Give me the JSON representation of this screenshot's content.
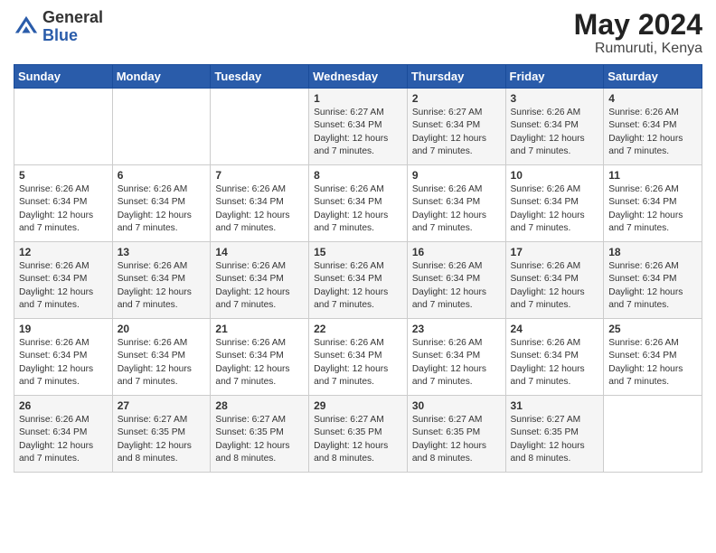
{
  "header": {
    "logo_general": "General",
    "logo_blue": "Blue",
    "title": "May 2024",
    "location": "Rumuruti, Kenya"
  },
  "days_of_week": [
    "Sunday",
    "Monday",
    "Tuesday",
    "Wednesday",
    "Thursday",
    "Friday",
    "Saturday"
  ],
  "weeks": [
    [
      {
        "day": "",
        "info": ""
      },
      {
        "day": "",
        "info": ""
      },
      {
        "day": "",
        "info": ""
      },
      {
        "day": "1",
        "info": "Sunrise: 6:27 AM\nSunset: 6:34 PM\nDaylight: 12 hours\nand 7 minutes."
      },
      {
        "day": "2",
        "info": "Sunrise: 6:27 AM\nSunset: 6:34 PM\nDaylight: 12 hours\nand 7 minutes."
      },
      {
        "day": "3",
        "info": "Sunrise: 6:26 AM\nSunset: 6:34 PM\nDaylight: 12 hours\nand 7 minutes."
      },
      {
        "day": "4",
        "info": "Sunrise: 6:26 AM\nSunset: 6:34 PM\nDaylight: 12 hours\nand 7 minutes."
      }
    ],
    [
      {
        "day": "5",
        "info": "Sunrise: 6:26 AM\nSunset: 6:34 PM\nDaylight: 12 hours\nand 7 minutes."
      },
      {
        "day": "6",
        "info": "Sunrise: 6:26 AM\nSunset: 6:34 PM\nDaylight: 12 hours\nand 7 minutes."
      },
      {
        "day": "7",
        "info": "Sunrise: 6:26 AM\nSunset: 6:34 PM\nDaylight: 12 hours\nand 7 minutes."
      },
      {
        "day": "8",
        "info": "Sunrise: 6:26 AM\nSunset: 6:34 PM\nDaylight: 12 hours\nand 7 minutes."
      },
      {
        "day": "9",
        "info": "Sunrise: 6:26 AM\nSunset: 6:34 PM\nDaylight: 12 hours\nand 7 minutes."
      },
      {
        "day": "10",
        "info": "Sunrise: 6:26 AM\nSunset: 6:34 PM\nDaylight: 12 hours\nand 7 minutes."
      },
      {
        "day": "11",
        "info": "Sunrise: 6:26 AM\nSunset: 6:34 PM\nDaylight: 12 hours\nand 7 minutes."
      }
    ],
    [
      {
        "day": "12",
        "info": "Sunrise: 6:26 AM\nSunset: 6:34 PM\nDaylight: 12 hours\nand 7 minutes."
      },
      {
        "day": "13",
        "info": "Sunrise: 6:26 AM\nSunset: 6:34 PM\nDaylight: 12 hours\nand 7 minutes."
      },
      {
        "day": "14",
        "info": "Sunrise: 6:26 AM\nSunset: 6:34 PM\nDaylight: 12 hours\nand 7 minutes."
      },
      {
        "day": "15",
        "info": "Sunrise: 6:26 AM\nSunset: 6:34 PM\nDaylight: 12 hours\nand 7 minutes."
      },
      {
        "day": "16",
        "info": "Sunrise: 6:26 AM\nSunset: 6:34 PM\nDaylight: 12 hours\nand 7 minutes."
      },
      {
        "day": "17",
        "info": "Sunrise: 6:26 AM\nSunset: 6:34 PM\nDaylight: 12 hours\nand 7 minutes."
      },
      {
        "day": "18",
        "info": "Sunrise: 6:26 AM\nSunset: 6:34 PM\nDaylight: 12 hours\nand 7 minutes."
      }
    ],
    [
      {
        "day": "19",
        "info": "Sunrise: 6:26 AM\nSunset: 6:34 PM\nDaylight: 12 hours\nand 7 minutes."
      },
      {
        "day": "20",
        "info": "Sunrise: 6:26 AM\nSunset: 6:34 PM\nDaylight: 12 hours\nand 7 minutes."
      },
      {
        "day": "21",
        "info": "Sunrise: 6:26 AM\nSunset: 6:34 PM\nDaylight: 12 hours\nand 7 minutes."
      },
      {
        "day": "22",
        "info": "Sunrise: 6:26 AM\nSunset: 6:34 PM\nDaylight: 12 hours\nand 7 minutes."
      },
      {
        "day": "23",
        "info": "Sunrise: 6:26 AM\nSunset: 6:34 PM\nDaylight: 12 hours\nand 7 minutes."
      },
      {
        "day": "24",
        "info": "Sunrise: 6:26 AM\nSunset: 6:34 PM\nDaylight: 12 hours\nand 7 minutes."
      },
      {
        "day": "25",
        "info": "Sunrise: 6:26 AM\nSunset: 6:34 PM\nDaylight: 12 hours\nand 7 minutes."
      }
    ],
    [
      {
        "day": "26",
        "info": "Sunrise: 6:26 AM\nSunset: 6:34 PM\nDaylight: 12 hours\nand 7 minutes."
      },
      {
        "day": "27",
        "info": "Sunrise: 6:27 AM\nSunset: 6:35 PM\nDaylight: 12 hours\nand 8 minutes."
      },
      {
        "day": "28",
        "info": "Sunrise: 6:27 AM\nSunset: 6:35 PM\nDaylight: 12 hours\nand 8 minutes."
      },
      {
        "day": "29",
        "info": "Sunrise: 6:27 AM\nSunset: 6:35 PM\nDaylight: 12 hours\nand 8 minutes."
      },
      {
        "day": "30",
        "info": "Sunrise: 6:27 AM\nSunset: 6:35 PM\nDaylight: 12 hours\nand 8 minutes."
      },
      {
        "day": "31",
        "info": "Sunrise: 6:27 AM\nSunset: 6:35 PM\nDaylight: 12 hours\nand 8 minutes."
      },
      {
        "day": "",
        "info": ""
      }
    ]
  ]
}
